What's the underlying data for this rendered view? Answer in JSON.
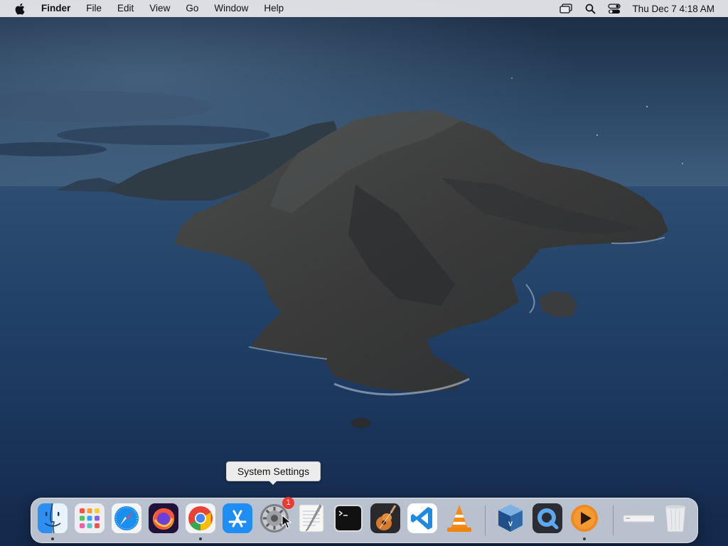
{
  "menubar": {
    "app_name": "Finder",
    "items": [
      "File",
      "Edit",
      "View",
      "Go",
      "Window",
      "Help"
    ],
    "clock": "Thu Dec 7  4:18 AM"
  },
  "tooltip": {
    "text": "System Settings"
  },
  "dock": {
    "apps": [
      {
        "name": "Finder",
        "icon": "finder-icon",
        "running": true
      },
      {
        "name": "Launchpad",
        "icon": "launchpad-icon",
        "running": false
      },
      {
        "name": "Safari",
        "icon": "safari-icon",
        "running": false
      },
      {
        "name": "Firefox",
        "icon": "firefox-icon",
        "running": false
      },
      {
        "name": "Google Chrome",
        "icon": "chrome-icon",
        "running": true
      },
      {
        "name": "App Store",
        "icon": "app-store-icon",
        "running": false
      },
      {
        "name": "System Settings",
        "icon": "system-settings-icon",
        "running": false,
        "badge": "1"
      },
      {
        "name": "TextEdit",
        "icon": "textedit-icon",
        "running": false
      },
      {
        "name": "Terminal",
        "icon": "terminal-icon",
        "running": false
      },
      {
        "name": "GarageBand",
        "icon": "garageband-icon",
        "running": false
      },
      {
        "name": "Visual Studio Code",
        "icon": "vscode-icon",
        "running": false
      },
      {
        "name": "VLC",
        "icon": "vlc-icon",
        "running": false
      },
      {
        "name": "VirtualBox",
        "icon": "virtualbox-icon",
        "running": false
      },
      {
        "name": "QuickTime Player",
        "icon": "quicktime-icon",
        "running": false
      },
      {
        "name": "Infuse",
        "icon": "media-player-icon",
        "running": true
      }
    ],
    "trash": {
      "name": "Trash",
      "icon": "trash-icon"
    }
  },
  "colors": {
    "menubar_bg": "#ececf0",
    "dock_bg": "#e8ecf4",
    "badge": "#ec3a32",
    "sea": "#1d3a5c",
    "sky": "#22364f"
  }
}
